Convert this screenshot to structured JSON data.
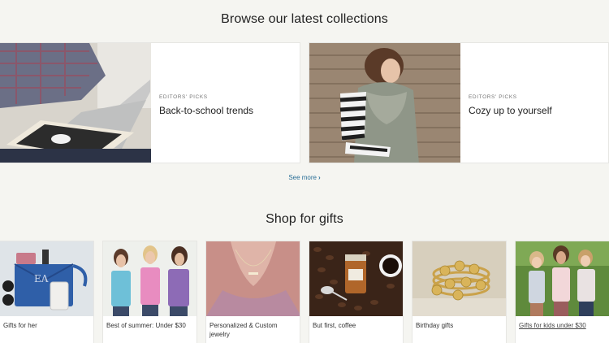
{
  "collections": {
    "title": "Browse our latest collections",
    "cards": [
      {
        "eyebrow": "EDITORS' PICKS",
        "name": "Back-to-school trends"
      },
      {
        "eyebrow": "EDITORS' PICKS",
        "name": "Cozy up to yourself"
      }
    ],
    "see_more": "See more",
    "see_more_icon": "chevron-right-icon"
  },
  "gifts": {
    "title": "Shop for gifts",
    "items": [
      {
        "label": "Gifts for her"
      },
      {
        "label": "Best of summer: Under $30"
      },
      {
        "label": "Personalized & Custom jewelry"
      },
      {
        "label": "But first, coffee"
      },
      {
        "label": "Birthday gifts"
      },
      {
        "label": "Gifts for kids under $30"
      }
    ]
  },
  "colors": {
    "page_bg": "#f5f5f1",
    "link": "#2a6f97"
  }
}
